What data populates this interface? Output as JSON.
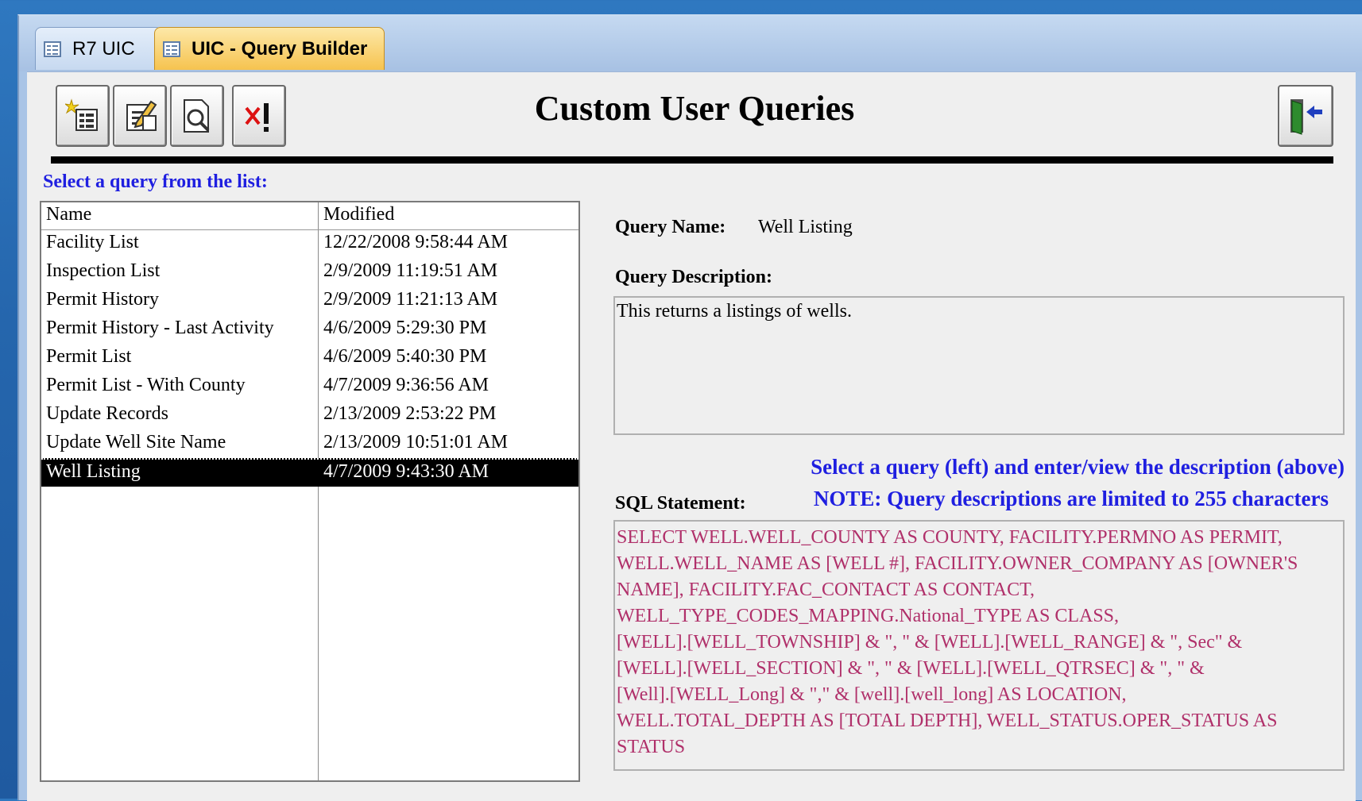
{
  "tabs": [
    {
      "label": "R7 UIC",
      "icon": "form-icon"
    },
    {
      "label": "UIC - Query Builder",
      "icon": "form-icon"
    }
  ],
  "toolbar": {
    "buttons": [
      {
        "name": "new-query-button",
        "icon": "new-query-icon"
      },
      {
        "name": "edit-query-button",
        "icon": "edit-query-icon"
      },
      {
        "name": "preview-query-button",
        "icon": "preview-icon"
      },
      {
        "name": "delete-query-button",
        "icon": "delete-icon"
      }
    ],
    "exit_icon": "exit-door-icon"
  },
  "page_title": "Custom User Queries",
  "list": {
    "prompt": "Select a query from the list:",
    "columns": [
      "Name",
      "Modified"
    ],
    "rows": [
      {
        "name": "Facility List",
        "modified": "12/22/2008 9:58:44 AM"
      },
      {
        "name": "Inspection List",
        "modified": "2/9/2009 11:19:51 AM"
      },
      {
        "name": "Permit History",
        "modified": "2/9/2009 11:21:13 AM"
      },
      {
        "name": "Permit History - Last Activity",
        "modified": "4/6/2009 5:29:30 PM"
      },
      {
        "name": "Permit List",
        "modified": "4/6/2009 5:40:30 PM"
      },
      {
        "name": "Permit List - With County",
        "modified": "4/7/2009 9:36:56 AM"
      },
      {
        "name": "Update Records",
        "modified": "2/13/2009 2:53:22 PM"
      },
      {
        "name": "Update Well Site Name",
        "modified": "2/13/2009 10:51:01 AM"
      },
      {
        "name": "Well Listing",
        "modified": "4/7/2009 9:43:30 AM"
      }
    ],
    "selected_index": 8
  },
  "details": {
    "query_name_label": "Query Name:",
    "query_name_value": "Well Listing",
    "description_label": "Query Description:",
    "description_value": "This returns a listings of wells.",
    "note_line1": "Select a query (left) and enter/view the description (above)",
    "note_line2": "NOTE: Query descriptions are limited to 255 characters",
    "sql_label": "SQL Statement:",
    "sql_lines": [
      "SELECT WELL.WELL_COUNTY AS COUNTY, FACILITY.PERMNO AS PERMIT,",
      "WELL.WELL_NAME AS [WELL #], FACILITY.OWNER_COMPANY AS [OWNER'S",
      "NAME], FACILITY.FAC_CONTACT AS CONTACT,",
      "WELL_TYPE_CODES_MAPPING.National_TYPE AS CLASS,",
      "[WELL].[WELL_TOWNSHIP] & \", \" & [WELL].[WELL_RANGE] & \", Sec\" &",
      "[WELL].[WELL_SECTION] & \", \" & [WELL].[WELL_QTRSEC] & \", \" &",
      "[Well].[WELL_Long] & \",\" & [well].[well_long] AS LOCATION,",
      "WELL.TOTAL_DEPTH AS [TOTAL DEPTH], WELL_STATUS.OPER_STATUS AS",
      "STATUS"
    ]
  }
}
